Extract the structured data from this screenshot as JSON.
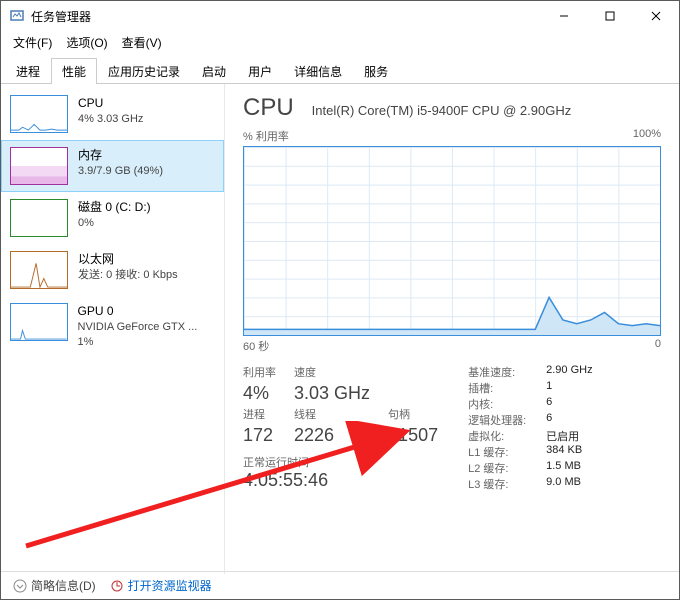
{
  "title": "任务管理器",
  "menu": {
    "file": "文件(F)",
    "options": "选项(O)",
    "view": "查看(V)"
  },
  "tabs": [
    "进程",
    "性能",
    "应用历史记录",
    "启动",
    "用户",
    "详细信息",
    "服务"
  ],
  "active_tab": 1,
  "sidebar": [
    {
      "name": "CPU",
      "val": "4% 3.03 GHz",
      "color": "#3a8edb"
    },
    {
      "name": "内存",
      "val": "3.9/7.9 GB (49%)",
      "color": "#a030a0"
    },
    {
      "name": "磁盘 0 (C: D:)",
      "val": "0%",
      "color": "#2a8a2a"
    },
    {
      "name": "以太网",
      "val": "发送: 0 接收: 0 Kbps",
      "color": "#b36b2a"
    },
    {
      "name": "GPU 0",
      "val": "NVIDIA GeForce GTX ... 1%",
      "color": "#3a8edb"
    }
  ],
  "cpu": {
    "label": "CPU",
    "model": "Intel(R) Core(TM) i5-9400F CPU @ 2.90GHz",
    "chart_top_left": "% 利用率",
    "chart_top_right": "100%",
    "chart_bot_left": "60 秒",
    "chart_bot_right": "0"
  },
  "stats_left": {
    "util_lbl": "利用率",
    "util": "4%",
    "speed_lbl": "速度",
    "speed": "3.03 GHz",
    "proc_lbl": "进程",
    "proc": "172",
    "thread_lbl": "线程",
    "thread": "2226",
    "handle_lbl": "句柄",
    "handle": "81507",
    "uptime_lbl": "正常运行时间",
    "uptime": "4:05:55:46"
  },
  "stats_right": {
    "base_lbl": "基准速度:",
    "base": "2.90 GHz",
    "socket_lbl": "插槽:",
    "socket": "1",
    "core_lbl": "内核:",
    "core": "6",
    "lp_lbl": "逻辑处理器:",
    "lp": "6",
    "virt_lbl": "虚拟化:",
    "virt": "已启用",
    "l1_lbl": "L1 缓存:",
    "l1": "384 KB",
    "l2_lbl": "L2 缓存:",
    "l2": "1.5 MB",
    "l3_lbl": "L3 缓存:",
    "l3": "9.0 MB"
  },
  "footer": {
    "simple": "简略信息(D)",
    "resmon": "打开资源监视器"
  },
  "chart_data": {
    "type": "line",
    "title": "% 利用率",
    "xlabel": "60 秒",
    "ylabel": "",
    "ylim": [
      0,
      100
    ],
    "x": [
      0,
      2,
      4,
      6,
      8,
      10,
      12,
      14,
      16,
      18,
      20,
      22,
      24,
      26,
      28,
      30,
      32,
      34,
      36,
      38,
      40,
      42,
      44,
      46,
      48,
      50,
      52,
      54,
      56,
      58,
      60
    ],
    "values": [
      3,
      3,
      3,
      3,
      3,
      3,
      3,
      3,
      3,
      3,
      3,
      3,
      3,
      3,
      3,
      3,
      3,
      3,
      3,
      3,
      3,
      3,
      20,
      8,
      6,
      8,
      12,
      6,
      5,
      6,
      5
    ]
  }
}
